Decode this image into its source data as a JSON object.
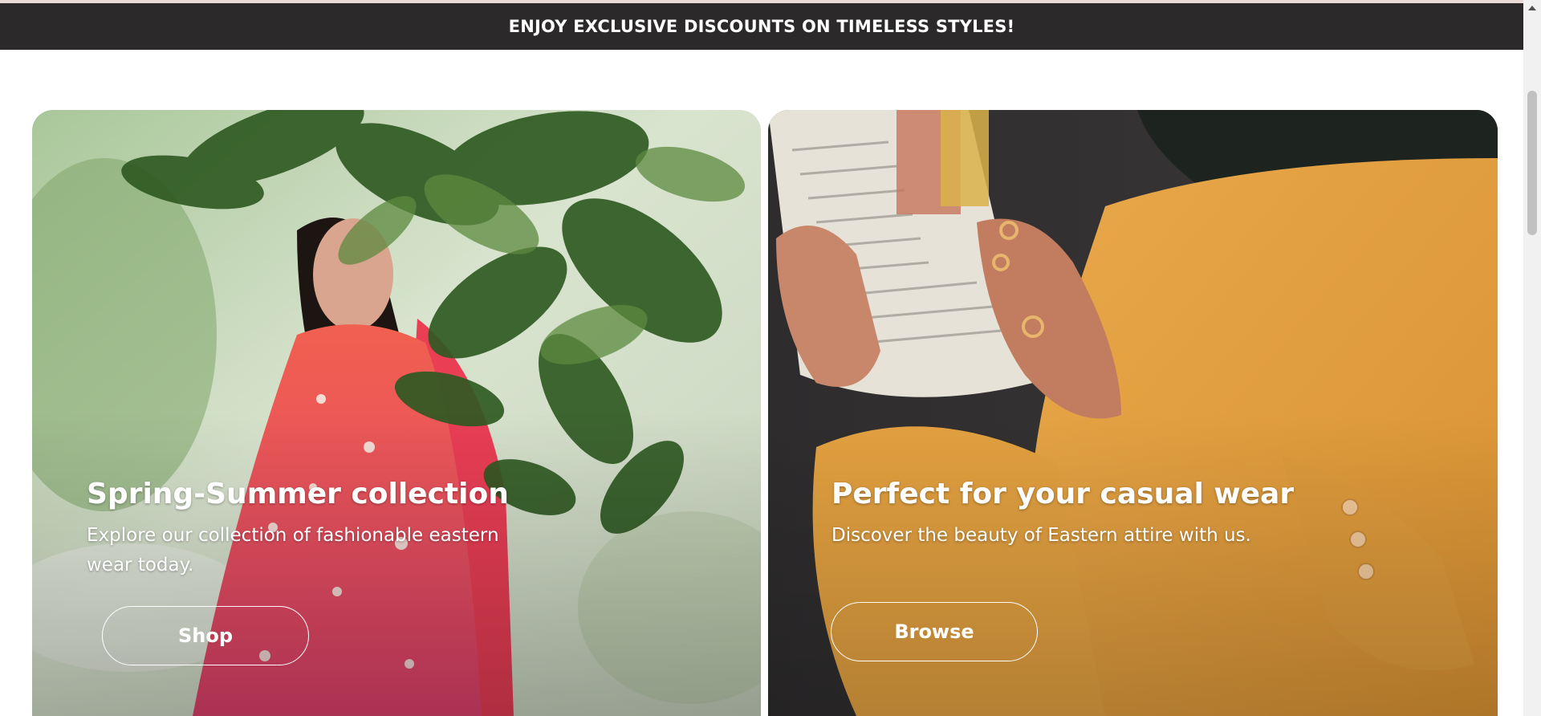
{
  "announcement": {
    "text": "ENJOY EXCLUSIVE DISCOUNTS ON TIMELESS STYLES!"
  },
  "cards": [
    {
      "title": "Spring-Summer collection",
      "description": "Explore our collection of fashionable eastern wear today.",
      "button_label": "Shop",
      "image_subject": "woman in pink floral outfit behind green leaves"
    },
    {
      "title": "Perfect for your casual wear",
      "description": "Discover the beauty of Eastern attire with us.",
      "button_label": "Browse",
      "image_subject": "person in mustard kurta reading a newspaper"
    }
  ],
  "colors": {
    "announcement_bg": "#2b292a",
    "text_on_image": "#ffffff",
    "page_bg": "#ffffff"
  },
  "icons": {
    "scroll_up": "scroll-up-arrow-icon"
  }
}
